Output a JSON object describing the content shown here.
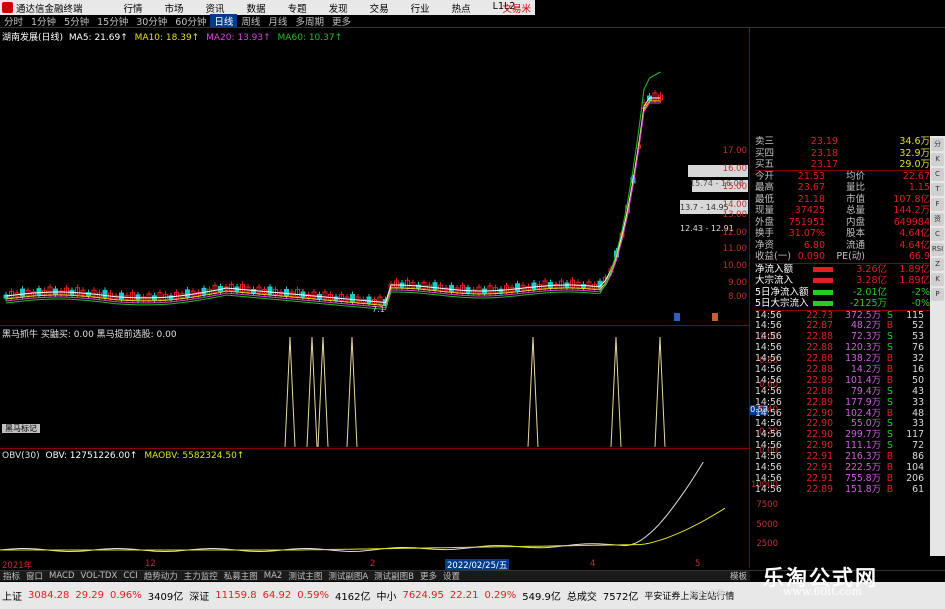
{
  "app": {
    "title": "通达信金融终端",
    "brand": "文易米"
  },
  "menu": [
    "行情",
    "市场",
    "资讯",
    "数据",
    "专题",
    "发现",
    "交易",
    "行业",
    "热点",
    "L1L2"
  ],
  "periods": {
    "items": [
      "分时",
      "1分钟",
      "5分钟",
      "15分钟",
      "30分钟",
      "60分钟",
      "日线",
      "周线",
      "月线",
      "多周期",
      "更多"
    ],
    "selected": "日线"
  },
  "stock": {
    "name": "湖南发展(日线)"
  },
  "ma": {
    "ma5": "MA5: 21.69↑",
    "ma10": "MA10: 18.39↑",
    "ma20": "MA20: 13.93↑",
    "ma60": "MA60: 10.37↑"
  },
  "price_axis": [
    "17.00",
    "16.00",
    "15.00",
    "14.00",
    "13.00",
    "12.00",
    "11.00",
    "10.00",
    "9.00",
    "8.00"
  ],
  "annotations": {
    "a1": "15.74 - 16.08",
    "a2": "13.7 - 14.95",
    "a3": "12.43 - 12.91",
    "low": "7.1"
  },
  "indicator1": {
    "legend": "黑马抓牛 买鼬买: 0.00 黑马提前选股: 0.00",
    "value_badge": "0.53",
    "axis": [
      "1.00",
      "0.80",
      "0.60",
      "0.40",
      "0.20",
      "0.00"
    ],
    "button": "黑马标记"
  },
  "indicator2": {
    "name": "OBV(30)",
    "obv": "OBV: 12751226.00↑",
    "maobv": "MAOBV: 5582324.50↑",
    "axis": [
      "10000",
      "7500",
      "5000",
      "2500"
    ]
  },
  "time_axis": [
    "2021年",
    "12",
    "2",
    "3",
    "4",
    "5"
  ],
  "time_highlight": "2022/02/25/五",
  "quote": {
    "ask_rows": [
      {
        "label": "卖三",
        "price": "23.19",
        "vol": "34.6万"
      },
      {
        "label": "买四",
        "price": "23.18",
        "vol": "32.9万"
      },
      {
        "label": "买五",
        "price": "23.17",
        "vol": "29.0万"
      }
    ],
    "stats": [
      {
        "l1": "今开",
        "v1": "21.53",
        "l2": "均价",
        "v2": "22.67"
      },
      {
        "l1": "最高",
        "v1": "23.67",
        "l2": "量比",
        "v2": "1.15"
      },
      {
        "l1": "最低",
        "v1": "21.18",
        "l2": "市值",
        "v2": "107.8亿"
      },
      {
        "l1": "现量",
        "v1": "37425",
        "l2": "总量",
        "v2": "144.2万"
      },
      {
        "l1": "外盘",
        "v1": "751951",
        "l2": "内盘",
        "v2": "649984"
      },
      {
        "l1": "换手",
        "v1": "31.07%",
        "l2": "股本",
        "v2": "4.64亿"
      },
      {
        "l1": "净资",
        "v1": "6.80",
        "l2": "流通",
        "v2": "4.64亿"
      },
      {
        "l1": "收益(一)",
        "v1": "0.090",
        "l2": "PE(动)",
        "v2": "66.9"
      }
    ],
    "flows": [
      {
        "label": "净流入额",
        "v1": "3.26亿",
        "v2": "1.89亿"
      },
      {
        "label": "大宗流入",
        "v1": "3.28亿",
        "v2": "1.89亿"
      },
      {
        "label": "5日净流入额",
        "v1": "-2.01亿",
        "v2": "-2%"
      },
      {
        "label": "5日大宗流入",
        "v1": "-2125万",
        "v2": "-0%"
      }
    ],
    "trades": [
      {
        "t": "14:56",
        "p": "22.73",
        "v": "372.5万",
        "d": "S",
        "n": "115"
      },
      {
        "t": "14:56",
        "p": "22.87",
        "v": "48.2万",
        "d": "B",
        "n": "52"
      },
      {
        "t": "14:56",
        "p": "22.88",
        "v": "72.3万",
        "d": "S",
        "n": "53"
      },
      {
        "t": "14:56",
        "p": "22.88",
        "v": "120.3万",
        "d": "S",
        "n": "76"
      },
      {
        "t": "14:56",
        "p": "22.88",
        "v": "138.2万",
        "d": "B",
        "n": "32"
      },
      {
        "t": "14:56",
        "p": "22.88",
        "v": "14.2万",
        "d": "B",
        "n": "16"
      },
      {
        "t": "14:56",
        "p": "22.89",
        "v": "101.4万",
        "d": "B",
        "n": "50"
      },
      {
        "t": "14:56",
        "p": "22.88",
        "v": "79.4万",
        "d": "S",
        "n": "43"
      },
      {
        "t": "14:56",
        "p": "22.89",
        "v": "177.9万",
        "d": "S",
        "n": "33"
      },
      {
        "t": "14:56",
        "p": "22.90",
        "v": "102.4万",
        "d": "B",
        "n": "48"
      },
      {
        "t": "14:56",
        "p": "22.90",
        "v": "55.0万",
        "d": "S",
        "n": "33"
      },
      {
        "t": "14:56",
        "p": "22.90",
        "v": "299.7万",
        "d": "S",
        "n": "117"
      },
      {
        "t": "14:56",
        "p": "22.90",
        "v": "111.1万",
        "d": "S",
        "n": "72"
      },
      {
        "t": "14:56",
        "p": "22.91",
        "v": "216.3万",
        "d": "B",
        "n": "86"
      },
      {
        "t": "14:56",
        "p": "22.91",
        "v": "222.5万",
        "d": "B",
        "n": "104"
      },
      {
        "t": "14:56",
        "p": "22.91",
        "v": "755.8万",
        "d": "B",
        "n": "206"
      },
      {
        "t": "14:56",
        "p": "22.89",
        "v": "151.8万",
        "d": "B",
        "n": "61"
      }
    ]
  },
  "tabs": {
    "items": [
      "指标",
      "窗口",
      "MACD",
      "VOL-TDX",
      "CCI",
      "趋势动力",
      "主力监控",
      "私募主图",
      "MA2",
      "测试主图",
      "测试副图A",
      "测试副图B",
      "更多",
      "设置"
    ],
    "green_items": [
      "综合资讯",
      "行业资讯",
      "互动问答",
      "省用户福利专享"
    ],
    "left_items": [
      "扩展A",
      "关联报价",
      "资金分布"
    ],
    "right": "模板"
  },
  "status": {
    "sh": {
      "label": "上证",
      "val": "3084.28",
      "chg": "29.29",
      "pct": "0.96%",
      "amt": "3409亿"
    },
    "sz": {
      "label": "深证",
      "val": "11159.8",
      "chg": "64.92",
      "pct": "0.59%",
      "amt": "4162亿"
    },
    "zx": {
      "label": "中小",
      "val": "7624.95",
      "chg": "22.21",
      "pct": "0.29%",
      "amt": "549.9亿"
    },
    "total_label": "总成交",
    "total": "7572亿",
    "server": "平安证券上海主站行情",
    "help": "按F10看"
  },
  "watermark": {
    "big": "乐淘公式网",
    "url": "www.60lt.com"
  },
  "right_strip": [
    "分",
    "K",
    "C",
    "T",
    "F",
    "资",
    "C",
    "RSI",
    "Z",
    "K",
    "P"
  ],
  "colors": {
    "up": "#e02020",
    "down": "#20d020",
    "ma5": "#ffffff",
    "ma10": "#e0e020",
    "ma20": "#e040e0",
    "ma60": "#20c020"
  }
}
